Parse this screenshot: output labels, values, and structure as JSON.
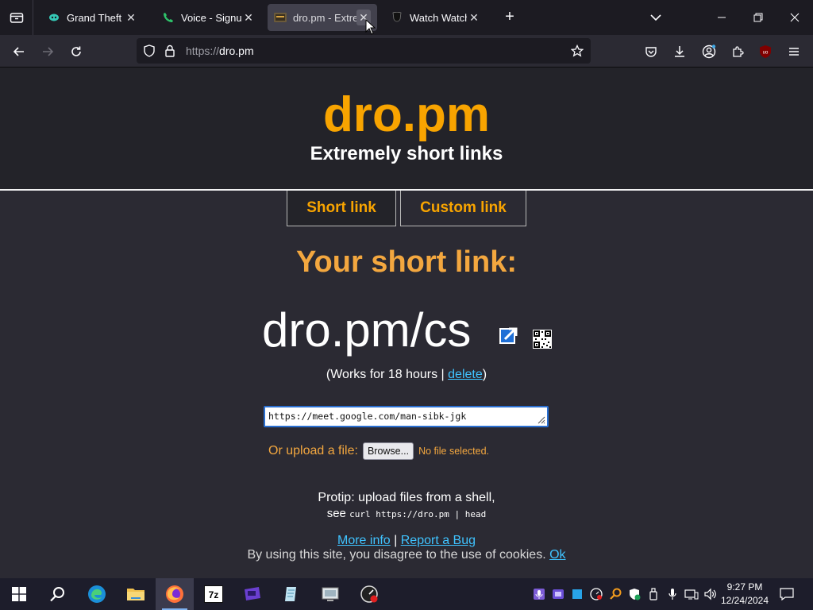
{
  "browser": {
    "tabs": [
      {
        "title": "Grand Theft Aut",
        "icon": "discord-like-icon",
        "active": false
      },
      {
        "title": "Voice - Signup",
        "icon": "phone-icon",
        "active": false
      },
      {
        "title": "dro.pm - Extre",
        "icon": "site-favicon",
        "active": true
      },
      {
        "title": "Watch Watch Fa",
        "icon": "mask-icon",
        "active": false
      }
    ],
    "url_protocol": "https://",
    "url_host": "dro.pm"
  },
  "page": {
    "logo": "dro.pm",
    "tagline": "Extremely short links",
    "mode_tabs": [
      "Short link",
      "Custom link"
    ],
    "heading": "Your short link:",
    "short_link": "dro.pm/cs",
    "works_prefix": "(Works for 18 hours | ",
    "delete_label": "delete",
    "works_suffix": ")",
    "input_value": "https://meet.google.com/man-sibk-jgk",
    "upload_label": "Or upload a file:",
    "browse_label": "Browse...",
    "no_file_label": "No file selected.",
    "protip_line1": "Protip: upload files from a shell,",
    "protip_see": "see",
    "protip_cmd": "curl https://dro.pm | head",
    "more_info": "More info",
    "links_sep": " | ",
    "report_bug": "Report a Bug",
    "cookie_text": "By using this site, you disagree to the use of cookies. ",
    "cookie_ok": "Ok"
  },
  "taskbar": {
    "time": "9:27 PM",
    "date": "12/24/2024"
  },
  "colors": {
    "accent": "#f8a400",
    "link": "#3fc3ff",
    "page_bg": "#2b2a33",
    "header_bg": "#232329"
  }
}
